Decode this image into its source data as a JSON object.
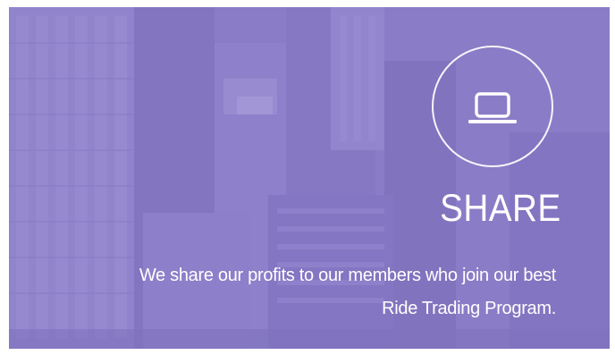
{
  "feature": {
    "icon": "laptop-icon",
    "title": "SHARE",
    "description_line1": "We share our profits to our members who join our best",
    "description_line2": "Ride Trading Program."
  },
  "colors": {
    "panel_base": "#8678c4",
    "text": "#ffffff"
  }
}
